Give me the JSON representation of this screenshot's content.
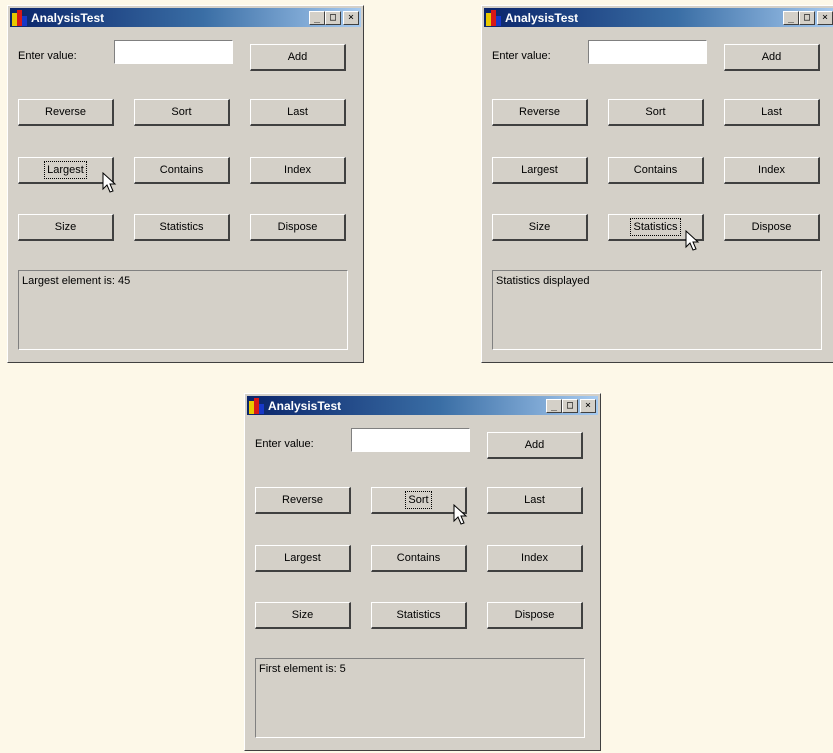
{
  "windows": [
    {
      "title": "AnalysisTest",
      "controls": {
        "minimize": "_",
        "maximize": "□",
        "close": "×"
      },
      "input_label": "Enter value:",
      "input_value": "",
      "buttons": [
        "Add",
        "Reverse",
        "Sort",
        "Last",
        "Largest",
        "Contains",
        "Index",
        "Size",
        "Statistics",
        "Dispose"
      ],
      "output_text": "Largest element is: 45"
    },
    {
      "title": "AnalysisTest",
      "controls": {
        "minimize": "_",
        "maximize": "□",
        "close": "×"
      },
      "input_label": "Enter value:",
      "input_value": "",
      "buttons": [
        "Add",
        "Reverse",
        "Sort",
        "Last",
        "Largest",
        "Contains",
        "Index",
        "Size",
        "Statistics",
        "Dispose"
      ],
      "output_text": "Statistics displayed"
    },
    {
      "title": "AnalysisTest",
      "controls": {
        "minimize": "_",
        "maximize": "□",
        "close": "×"
      },
      "input_label": "Enter value:",
      "input_value": "",
      "buttons": [
        "Add",
        "Reverse",
        "Sort",
        "Last",
        "Largest",
        "Contains",
        "Index",
        "Size",
        "Statistics",
        "Dispose"
      ],
      "output_text": "First element is: 5"
    }
  ],
  "colors": {
    "desktop": "#fdf8e8",
    "window_face": "#d4d0c8",
    "title_start": "#0a246a",
    "title_end": "#a6caf0"
  },
  "icons": [
    "app-icon",
    "minimize-icon",
    "maximize-icon",
    "close-icon",
    "mouse-pointer-icon"
  ]
}
